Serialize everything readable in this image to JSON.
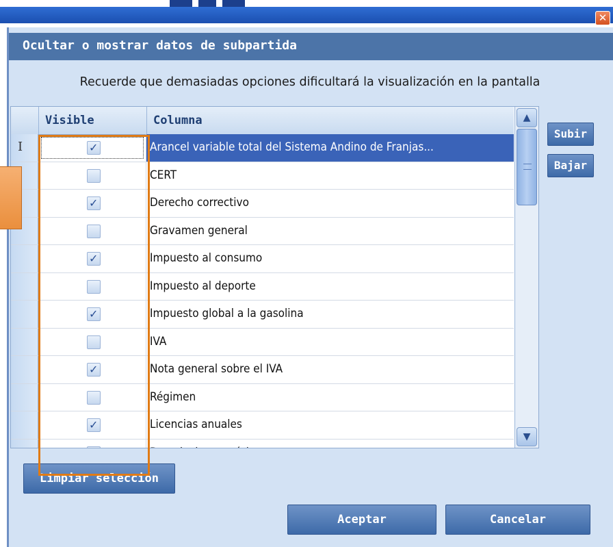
{
  "window": {
    "close_glyph": "✕"
  },
  "dialog": {
    "title": "Ocultar o mostrar datos de subpartida",
    "warning": "Recuerde que demasiadas opciones dificultará la visualización en la pantalla"
  },
  "grid": {
    "headers": {
      "visible": "Visible",
      "column": "Columna"
    },
    "row_cursor": "I",
    "rows": [
      {
        "label": "Arancel variable total del Sistema Andino de Franjas...",
        "checked": true,
        "selected": true
      },
      {
        "label": "CERT",
        "checked": false,
        "selected": false
      },
      {
        "label": "Derecho correctivo",
        "checked": true,
        "selected": false
      },
      {
        "label": "Gravamen general",
        "checked": false,
        "selected": false
      },
      {
        "label": "Impuesto al consumo",
        "checked": true,
        "selected": false
      },
      {
        "label": "Impuesto al deporte",
        "checked": false,
        "selected": false
      },
      {
        "label": "Impuesto global a la gasolina",
        "checked": true,
        "selected": false
      },
      {
        "label": "IVA",
        "checked": false,
        "selected": false
      },
      {
        "label": "Nota general sobre el IVA",
        "checked": true,
        "selected": false
      },
      {
        "label": "Régimen",
        "checked": false,
        "selected": false
      },
      {
        "label": "Licencias anuales",
        "checked": true,
        "selected": false
      },
      {
        "label": "Descripciones mínimas",
        "checked": false,
        "selected": false
      }
    ],
    "check_glyph": "✓",
    "scroll_up_glyph": "▲",
    "scroll_down_glyph": "▼"
  },
  "buttons": {
    "move_up": "Subir",
    "move_down": "Bajar",
    "clear_selection": "Limpiar selección",
    "accept": "Aceptar",
    "cancel": "Cancelar"
  },
  "colors": {
    "title_bar": "#4c74a8",
    "dialog_bg": "#d3e2f4",
    "selection": "#3a63b8",
    "highlight_box": "#e07b16",
    "button": "#3d6aa8"
  }
}
